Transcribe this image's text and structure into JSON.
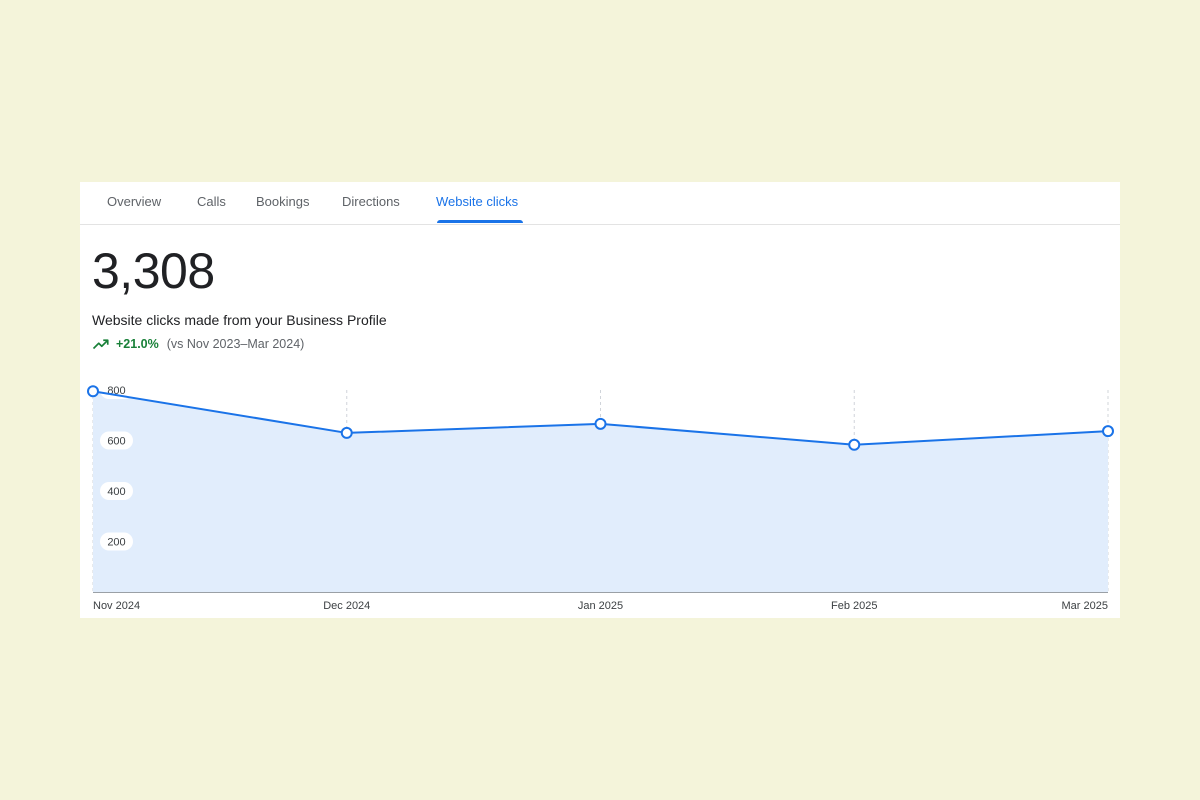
{
  "tabs": [
    {
      "label": "Overview",
      "active": false
    },
    {
      "label": "Calls",
      "active": false
    },
    {
      "label": "Bookings",
      "active": false
    },
    {
      "label": "Directions",
      "active": false
    },
    {
      "label": "Website clicks",
      "active": true
    }
  ],
  "summary": {
    "total": "3,308",
    "description": "Website clicks made from your Business Profile",
    "change_percent": "+21.0%",
    "comparison": "(vs Nov 2023–Mar 2024)",
    "trend_icon": "trending-up-icon"
  },
  "colors": {
    "accent": "#1a73e8",
    "positive": "#188038",
    "area_fill": "#e1edfc"
  },
  "chart_data": {
    "type": "area",
    "categories": [
      "Nov 2024",
      "Dec 2024",
      "Jan 2025",
      "Feb 2025",
      "Mar 2025"
    ],
    "values": [
      795,
      630,
      666,
      583,
      637
    ],
    "y_ticks": [
      "200",
      "400",
      "600",
      "800"
    ],
    "ylim": [
      0,
      800
    ],
    "grid": "vertical dashed",
    "markers": true
  }
}
